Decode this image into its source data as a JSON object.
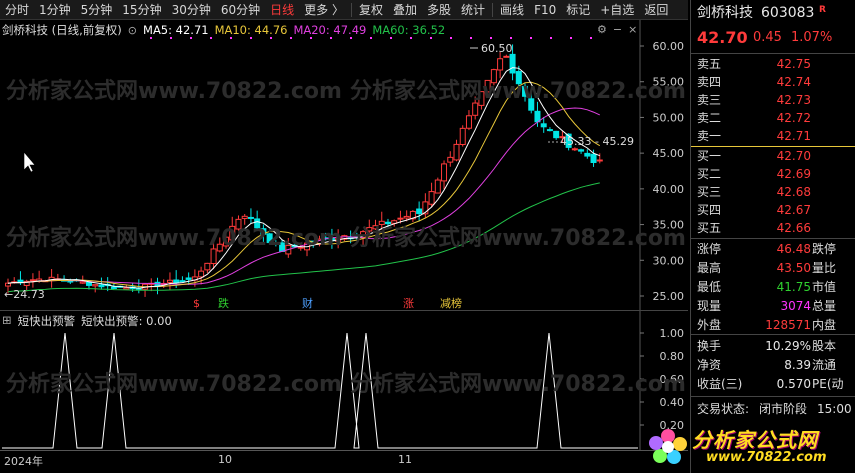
{
  "toolbar": {
    "items": [
      {
        "label": "分时",
        "name": "tb-intraday"
      },
      {
        "label": "1分钟",
        "name": "tb-1min"
      },
      {
        "label": "5分钟",
        "name": "tb-5min"
      },
      {
        "label": "15分钟",
        "name": "tb-15min"
      },
      {
        "label": "30分钟",
        "name": "tb-30min"
      },
      {
        "label": "60分钟",
        "name": "tb-60min"
      },
      {
        "label": "日线",
        "name": "tb-daily",
        "active": true
      },
      {
        "label": "更多 〉",
        "name": "tb-more"
      },
      {
        "label": "复权",
        "name": "tb-adjust"
      },
      {
        "label": "叠加",
        "name": "tb-overlay"
      },
      {
        "label": "多股",
        "name": "tb-multi"
      },
      {
        "label": "统计",
        "name": "tb-stats"
      },
      {
        "label": "画线",
        "name": "tb-draw"
      },
      {
        "label": "F10",
        "name": "tb-f10"
      },
      {
        "label": "标记",
        "name": "tb-mark"
      },
      {
        "label": "+自选",
        "name": "tb-add-watch"
      },
      {
        "label": "返回",
        "name": "tb-back"
      }
    ]
  },
  "legend": {
    "stock": "剑桥科技 (日线,前复权)",
    "ma5": "MA5: 42.71",
    "ma10": "MA10: 44.76",
    "ma20": "MA20: 47.49",
    "ma60": "MA60: 36.52"
  },
  "colors": {
    "up": "#ff3b3b",
    "down": "#00e5e5",
    "ma5": "#ffffff",
    "ma10": "#e8c73a",
    "ma20": "#e040e0",
    "ma60": "#22c24a"
  },
  "main_chart": {
    "y_ticks": [
      "60.00",
      "55.00",
      "50.00",
      "45.00",
      "40.00",
      "35.00",
      "30.00",
      "25.00"
    ],
    "high_label": "60.50",
    "low_label": "←24.73",
    "price_line_label": "45.33 - 45.29",
    "events": [
      {
        "text": "$",
        "color": "#ff3b3b"
      },
      {
        "text": "跌",
        "color": "#2fcf2f"
      },
      {
        "text": "财",
        "color": "#4ea0ff"
      },
      {
        "text": "涨",
        "color": "#ff3b3b"
      },
      {
        "text": "减榜",
        "color": "#e8c73a"
      }
    ]
  },
  "indicator": {
    "name": "短快出预警",
    "value_label": "短快出预警: 0.00",
    "y_ticks": [
      "1.00",
      "0.80",
      "0.60",
      "0.40",
      "0.20"
    ]
  },
  "xaxis": {
    "labels": [
      "2024年",
      "10",
      "11"
    ]
  },
  "watermark": {
    "text1": "分析家公式网www.70822.com",
    "logo_text": "分析家公式网",
    "logo_url": "www.70822.com"
  },
  "panel": {
    "name": "剑桥科技",
    "code": "603083",
    "badge": "R",
    "price": "42.70",
    "change": "0.45",
    "change_pct": "1.07%",
    "asks": [
      {
        "label": "卖五",
        "price": "42.75"
      },
      {
        "label": "卖四",
        "price": "42.74"
      },
      {
        "label": "卖三",
        "price": "42.73"
      },
      {
        "label": "卖二",
        "price": "42.72"
      },
      {
        "label": "卖一",
        "price": "42.71"
      }
    ],
    "bids": [
      {
        "label": "买一",
        "price": "42.70"
      },
      {
        "label": "买二",
        "price": "42.69"
      },
      {
        "label": "买三",
        "price": "42.68"
      },
      {
        "label": "买四",
        "price": "42.67"
      },
      {
        "label": "买五",
        "price": "42.66"
      }
    ],
    "stats": [
      {
        "label": "涨停",
        "value": "46.48",
        "label2": "跌停",
        "color": "red"
      },
      {
        "label": "最高",
        "value": "43.50",
        "label2": "量比",
        "color": "red"
      },
      {
        "label": "最低",
        "value": "41.75",
        "label2": "市值",
        "color": "green"
      },
      {
        "label": "现量",
        "value": "3074",
        "label2": "总量",
        "color": "mag"
      },
      {
        "label": "外盘",
        "value": "128571",
        "label2": "内盘",
        "color": "red"
      }
    ],
    "stats2": [
      {
        "label": "换手",
        "value": "10.29%",
        "label2": "股本"
      },
      {
        "label": "净资",
        "value": "8.39",
        "label2": "流通"
      },
      {
        "label": "收益(三)",
        "value": "0.570",
        "label2": "PE(动"
      }
    ],
    "trade_status_label": "交易状态:",
    "trade_status": "闭市阶段",
    "trade_time": "15:00"
  }
}
